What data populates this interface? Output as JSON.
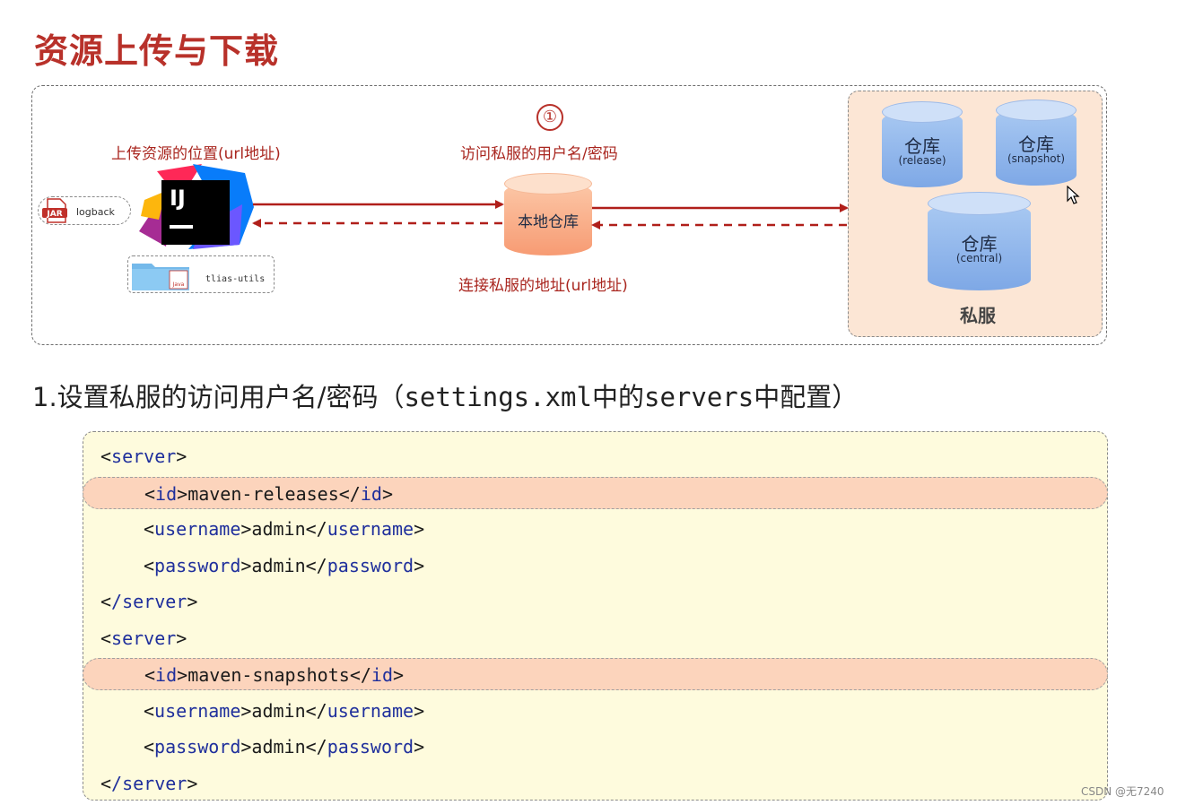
{
  "title": "资源上传与下载",
  "diagram": {
    "step_number": "①",
    "upload_label": "上传资源的位置(url地址)",
    "credentials_label": "访问私服的用户名/密码",
    "connect_label": "连接私服的地址(url地址)",
    "local_repo_label": "本地仓库",
    "ij_logo_text": "IJ",
    "jar_badge": "JAR",
    "jar_name": "logback",
    "folder_badge": "Java",
    "folder_name": "tlias-utils",
    "private_server_label": "私服",
    "repos": [
      {
        "name": "仓库",
        "type": "(release)"
      },
      {
        "name": "仓库",
        "type": "(snapshot)"
      },
      {
        "name": "仓库",
        "type": "(central)"
      }
    ],
    "colors": {
      "accent_red": "#b8312a",
      "repo_blue": "#7ea8e6",
      "local_orange": "#f79b73",
      "server_bg": "#fce6d5"
    }
  },
  "section": {
    "prefix": "1.设置私服的访问用户名/密码（",
    "file": "settings.xml",
    "middle": "中的",
    "element": "servers",
    "suffix": "中配置）"
  },
  "code_lines": [
    {
      "indent": "",
      "open_tag": "server",
      "value": "",
      "close_tag": "",
      "highlight": false
    },
    {
      "indent": "    ",
      "open_tag": "id",
      "value": "maven-releases",
      "close_tag": "id",
      "highlight": true
    },
    {
      "indent": "    ",
      "open_tag": "username",
      "value": "admin",
      "close_tag": "username",
      "highlight": false
    },
    {
      "indent": "    ",
      "open_tag": "password",
      "value": "admin",
      "close_tag": "password",
      "highlight": false
    },
    {
      "indent": "",
      "open_tag": "/server",
      "value": "",
      "close_tag": "",
      "highlight": false
    },
    {
      "indent": "",
      "open_tag": "server",
      "value": "",
      "close_tag": "",
      "highlight": false
    },
    {
      "indent": "    ",
      "open_tag": "id",
      "value": "maven-snapshots",
      "close_tag": "id",
      "highlight": true
    },
    {
      "indent": "    ",
      "open_tag": "username",
      "value": "admin",
      "close_tag": "username",
      "highlight": false
    },
    {
      "indent": "    ",
      "open_tag": "password",
      "value": "admin",
      "close_tag": "password",
      "highlight": false
    },
    {
      "indent": "",
      "open_tag": "/server",
      "value": "",
      "close_tag": "",
      "highlight": false
    }
  ],
  "watermark": "CSDN @无7240"
}
